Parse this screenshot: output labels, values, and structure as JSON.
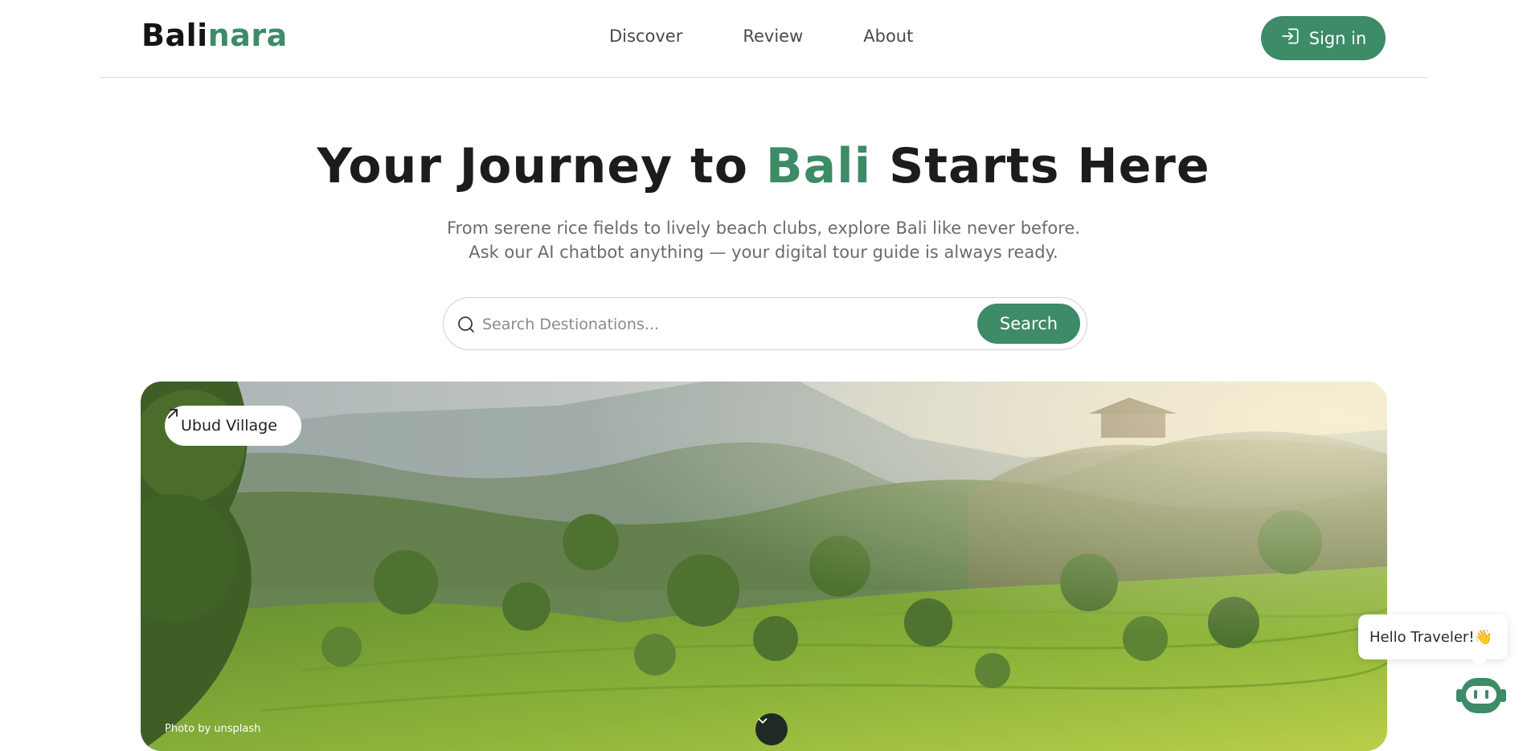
{
  "brand": {
    "name_part1": "Bali",
    "name_part2": "nara",
    "colors": {
      "accent": "#3d8b67",
      "dark": "#141414"
    }
  },
  "nav": {
    "items": [
      {
        "label": "Discover"
      },
      {
        "label": "Review"
      },
      {
        "label": "About"
      }
    ]
  },
  "header": {
    "signin_label": "Sign in",
    "signin_icon": "sign-in-icon"
  },
  "hero": {
    "title_before": "Your Journey to ",
    "title_accent": "Bali",
    "title_after": " Starts Here",
    "subtitle": "From serene rice fields to lively beach clubs, explore Bali like never before. Ask our AI chatbot anything — your digital tour guide is always ready."
  },
  "search": {
    "placeholder": "Search Destionations...",
    "value": "",
    "button_label": "Search",
    "icon": "search-icon"
  },
  "feature_image": {
    "place_label": "Ubud Village",
    "place_icon": "arrow-up-right-icon",
    "credit": "Photo by unsplash",
    "scroll_icon": "chevron-down-icon"
  },
  "chat": {
    "greeting": "Hello Traveler!👋",
    "bot_icon": "robot-icon"
  }
}
